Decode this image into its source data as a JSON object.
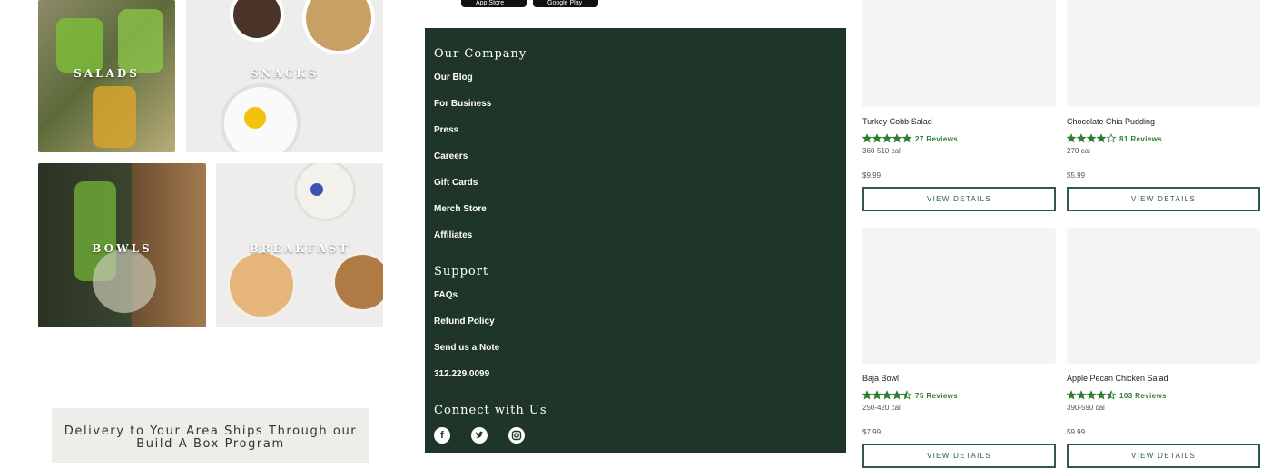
{
  "categories": {
    "salads": "SALADS",
    "snacks": "SNACKS",
    "bowls": "BOWLS",
    "breakfast": "BREAKFAST"
  },
  "delivery_banner": "Delivery to Your Area Ships Through our Build-A-Box Program",
  "app_badges": {
    "apple": "App Store",
    "google": "Google Play"
  },
  "footer": {
    "company_heading": "Our Company",
    "company_links": [
      "Our Blog",
      "For Business",
      "Press",
      "Careers",
      "Gift Cards",
      "Merch Store",
      "Affiliates"
    ],
    "support_heading": "Support",
    "support_links": [
      "FAQs",
      "Refund Policy",
      "Send us a Note",
      "312.229.0099"
    ],
    "connect_heading": "Connect with Us",
    "social_icons": [
      "facebook-icon",
      "twitter-icon",
      "instagram-icon"
    ]
  },
  "products": [
    {
      "name": "Turkey Cobb Salad",
      "rating": 5,
      "reviews": "27 Reviews",
      "calories": "360-510 cal",
      "price": "$9.99",
      "button": "VIEW DETAILS"
    },
    {
      "name": "Chocolate Chia Pudding",
      "rating": 4,
      "reviews": "81 Reviews",
      "calories": "270 cal",
      "price": "$5.99",
      "button": "VIEW DETAILS"
    },
    {
      "name": "Baja Bowl",
      "rating": 4.5,
      "reviews": "75 Reviews",
      "calories": "250-420 cal",
      "price": "$7.99",
      "button": "VIEW DETAILS"
    },
    {
      "name": "Apple Pecan Chicken Salad",
      "rating": 4.5,
      "reviews": "103 Reviews",
      "calories": "390-590 cal",
      "price": "$9.99",
      "button": "VIEW DETAILS"
    }
  ],
  "colors": {
    "footer_bg": "#203529",
    "accent_green": "#2e7d32",
    "button_border": "#2e5c43"
  }
}
